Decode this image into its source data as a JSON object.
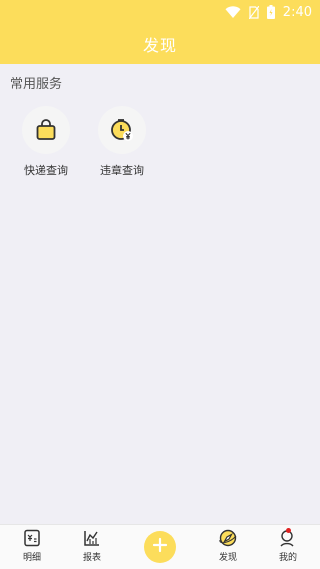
{
  "status_bar": {
    "time": "2:40"
  },
  "header": {
    "title": "发现"
  },
  "section": {
    "title": "常用服务"
  },
  "services": [
    {
      "label": "快递查询",
      "icon": "shopping-bag-icon"
    },
    {
      "label": "违章查询",
      "icon": "clock-yen-icon"
    }
  ],
  "tabbar": {
    "items": [
      {
        "label": "明细",
        "icon": "details-icon"
      },
      {
        "label": "报表",
        "icon": "chart-icon"
      },
      {
        "label": "发现",
        "icon": "compass-icon",
        "active": true
      },
      {
        "label": "我的",
        "icon": "user-icon",
        "badge": true
      }
    ],
    "add_icon": "plus-icon"
  },
  "colors": {
    "accent": "#fcdd5b",
    "background": "#f0eff5",
    "badge": "#e02020"
  }
}
